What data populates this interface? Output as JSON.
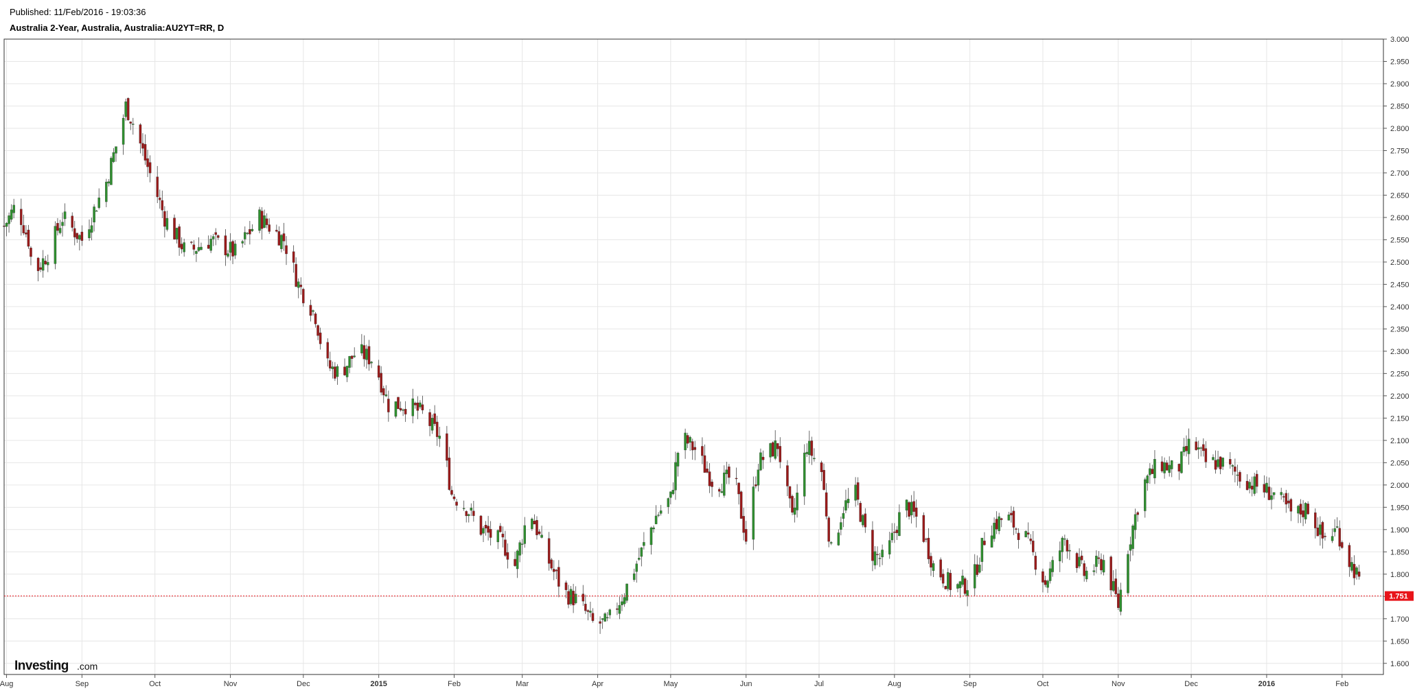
{
  "header": {
    "published": "Published: 11/Feb/2016 - 19:03:36",
    "title": "Australia 2-Year, Australia, Australia:AU2YT=RR, D"
  },
  "logo": {
    "main": "Investing",
    "suffix": ".com"
  },
  "colors": {
    "up": "#2f8f2f",
    "down": "#9a1a1a",
    "grid": "#e6e6e6",
    "last_price": "#e8141a"
  },
  "chart_data": {
    "type": "candlestick",
    "timeframe": "D",
    "x_ticks": [
      {
        "label": "Aug",
        "d": 1
      },
      {
        "label": "Sep",
        "d": 32
      },
      {
        "label": "Oct",
        "d": 62
      },
      {
        "label": "Nov",
        "d": 93
      },
      {
        "label": "Dec",
        "d": 123
      },
      {
        "label": "2015",
        "d": 154,
        "bold": true
      },
      {
        "label": "Feb",
        "d": 185
      },
      {
        "label": "Mar",
        "d": 213
      },
      {
        "label": "Apr",
        "d": 244
      },
      {
        "label": "May",
        "d": 274
      },
      {
        "label": "Jun",
        "d": 305
      },
      {
        "label": "Jul",
        "d": 335
      },
      {
        "label": "Aug",
        "d": 366
      },
      {
        "label": "Sep",
        "d": 397
      },
      {
        "label": "Oct",
        "d": 427
      },
      {
        "label": "Nov",
        "d": 458
      },
      {
        "label": "Dec",
        "d": 488
      },
      {
        "label": "2016",
        "d": 519,
        "bold": true
      },
      {
        "label": "Feb",
        "d": 550
      }
    ],
    "y_ticks": [
      "3.000",
      "2.950",
      "2.900",
      "2.850",
      "2.800",
      "2.750",
      "2.700",
      "2.650",
      "2.600",
      "2.550",
      "2.500",
      "2.450",
      "2.400",
      "2.350",
      "2.300",
      "2.250",
      "2.200",
      "2.150",
      "2.100",
      "2.050",
      "2.000",
      "1.950",
      "1.900",
      "1.850",
      "1.800",
      "1.750",
      "1.700",
      "1.650",
      "1.600"
    ],
    "ylim": [
      1.575,
      3.0
    ],
    "x_range": [
      0,
      567
    ],
    "last_price": 1.751,
    "last_price_label": "1.751",
    "grid": true,
    "anchors": [
      {
        "d": 0,
        "p": 2.58
      },
      {
        "d": 5,
        "p": 2.63
      },
      {
        "d": 10,
        "p": 2.55
      },
      {
        "d": 12,
        "p": 2.47
      },
      {
        "d": 18,
        "p": 2.52
      },
      {
        "d": 24,
        "p": 2.6
      },
      {
        "d": 32,
        "p": 2.55
      },
      {
        "d": 38,
        "p": 2.63
      },
      {
        "d": 42,
        "p": 2.68
      },
      {
        "d": 48,
        "p": 2.8
      },
      {
        "d": 50,
        "p": 2.85
      },
      {
        "d": 54,
        "p": 2.8
      },
      {
        "d": 58,
        "p": 2.73
      },
      {
        "d": 66,
        "p": 2.6
      },
      {
        "d": 75,
        "p": 2.52
      },
      {
        "d": 85,
        "p": 2.55
      },
      {
        "d": 95,
        "p": 2.52
      },
      {
        "d": 105,
        "p": 2.6
      },
      {
        "d": 115,
        "p": 2.55
      },
      {
        "d": 121,
        "p": 2.45
      },
      {
        "d": 128,
        "p": 2.38
      },
      {
        "d": 132,
        "p": 2.27
      },
      {
        "d": 138,
        "p": 2.25
      },
      {
        "d": 145,
        "p": 2.3
      },
      {
        "d": 152,
        "p": 2.28
      },
      {
        "d": 158,
        "p": 2.18
      },
      {
        "d": 166,
        "p": 2.18
      },
      {
        "d": 172,
        "p": 2.16
      },
      {
        "d": 180,
        "p": 2.1
      },
      {
        "d": 184,
        "p": 1.98
      },
      {
        "d": 190,
        "p": 1.95
      },
      {
        "d": 196,
        "p": 1.9
      },
      {
        "d": 205,
        "p": 1.87
      },
      {
        "d": 210,
        "p": 1.82
      },
      {
        "d": 216,
        "p": 1.95
      },
      {
        "d": 222,
        "p": 1.85
      },
      {
        "d": 230,
        "p": 1.76
      },
      {
        "d": 236,
        "p": 1.74
      },
      {
        "d": 242,
        "p": 1.69
      },
      {
        "d": 248,
        "p": 1.69
      },
      {
        "d": 255,
        "p": 1.76
      },
      {
        "d": 262,
        "p": 1.85
      },
      {
        "d": 268,
        "p": 1.93
      },
      {
        "d": 274,
        "p": 1.97
      },
      {
        "d": 278,
        "p": 2.11
      },
      {
        "d": 284,
        "p": 2.08
      },
      {
        "d": 292,
        "p": 2.0
      },
      {
        "d": 300,
        "p": 2.02
      },
      {
        "d": 305,
        "p": 1.88
      },
      {
        "d": 310,
        "p": 2.05
      },
      {
        "d": 318,
        "p": 2.09
      },
      {
        "d": 324,
        "p": 1.92
      },
      {
        "d": 330,
        "p": 2.09
      },
      {
        "d": 336,
        "p": 2.03
      },
      {
        "d": 340,
        "p": 1.85
      },
      {
        "d": 345,
        "p": 1.95
      },
      {
        "d": 350,
        "p": 1.98
      },
      {
        "d": 356,
        "p": 1.85
      },
      {
        "d": 362,
        "p": 1.83
      },
      {
        "d": 370,
        "p": 1.96
      },
      {
        "d": 376,
        "p": 1.92
      },
      {
        "d": 382,
        "p": 1.82
      },
      {
        "d": 390,
        "p": 1.77
      },
      {
        "d": 398,
        "p": 1.78
      },
      {
        "d": 404,
        "p": 1.9
      },
      {
        "d": 412,
        "p": 1.93
      },
      {
        "d": 420,
        "p": 1.88
      },
      {
        "d": 428,
        "p": 1.78
      },
      {
        "d": 436,
        "p": 1.88
      },
      {
        "d": 444,
        "p": 1.8
      },
      {
        "d": 452,
        "p": 1.83
      },
      {
        "d": 458,
        "p": 1.73
      },
      {
        "d": 462,
        "p": 1.86
      },
      {
        "d": 468,
        "p": 2.0
      },
      {
        "d": 475,
        "p": 2.05
      },
      {
        "d": 482,
        "p": 2.03
      },
      {
        "d": 488,
        "p": 2.1
      },
      {
        "d": 494,
        "p": 2.05
      },
      {
        "d": 500,
        "p": 2.05
      },
      {
        "d": 508,
        "p": 2.02
      },
      {
        "d": 514,
        "p": 2.0
      },
      {
        "d": 522,
        "p": 1.98
      },
      {
        "d": 530,
        "p": 1.93
      },
      {
        "d": 536,
        "p": 1.95
      },
      {
        "d": 542,
        "p": 1.88
      },
      {
        "d": 548,
        "p": 1.9
      },
      {
        "d": 552,
        "p": 1.84
      },
      {
        "d": 556,
        "p": 1.8
      },
      {
        "d": 558,
        "p": 1.751
      }
    ]
  }
}
